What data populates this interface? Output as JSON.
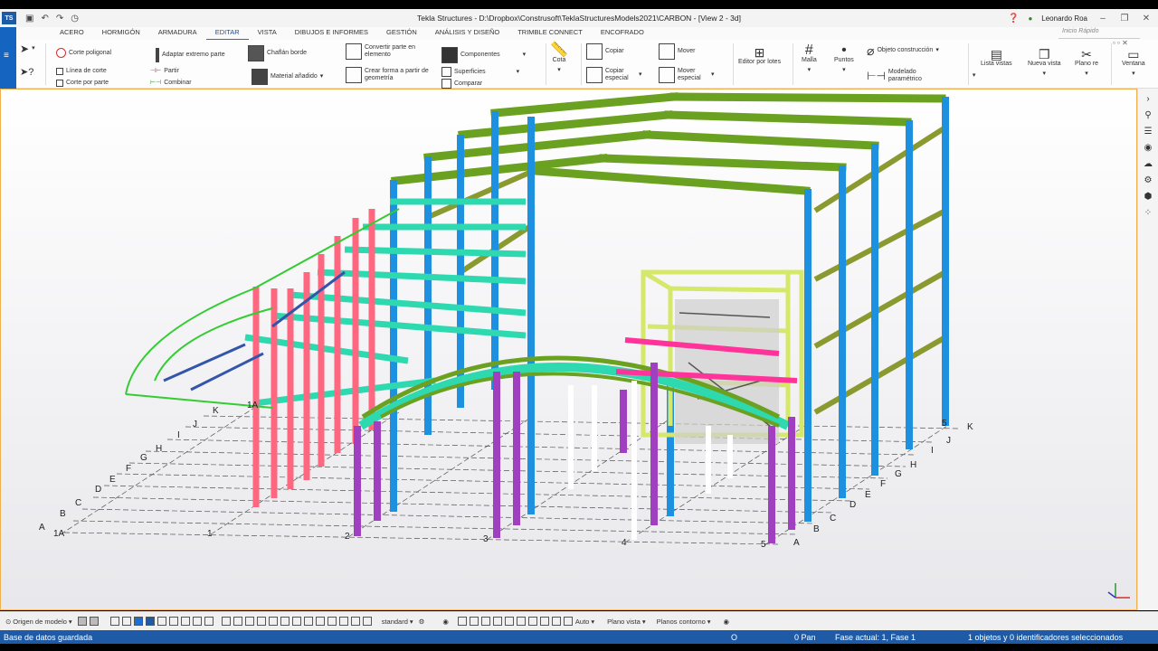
{
  "window": {
    "logo": "TS",
    "title": "Tekla Structures - D:\\Dropbox\\Construsoft\\TeklaStructuresModels2021\\CARBON  - [View 2 - 3d]",
    "user": "Leonardo Roa",
    "quick_search_placeholder": "Inicio Rápido"
  },
  "menu": {
    "items": [
      "ACERO",
      "HORMIGÓN",
      "ARMADURA",
      "EDITAR",
      "VISTA",
      "DIBUJOS E INFORMES",
      "GESTIÓN",
      "ANÁLISIS Y DISEÑO",
      "TRIMBLE CONNECT",
      "ENCOFRADO"
    ],
    "active": "EDITAR"
  },
  "ribbon": {
    "corte_poligonal": "Corte poligonal",
    "linea_de_corte": "Línea de corte",
    "corte_por_parte": "Corte por parte",
    "adaptar_extremo": "Adaptar extremo parte",
    "partir": "Partir",
    "combinar": "Combinar",
    "chaflan_borde": "Chaflán borde",
    "material_anadido": "Material añadido",
    "convertir": "Convertir parte en elemento",
    "crear_forma": "Crear forma a partir de geometría",
    "componentes": "Componentes",
    "superficies": "Superficies",
    "comparar": "Comparar",
    "cota": "Cota",
    "copiar": "Copiar",
    "copiar_especial": "Copiar especial",
    "mover": "Mover",
    "mover_especial": "Mover especial",
    "editor_lotes": "Editor por lotes",
    "malla": "Malla",
    "puntos": "Puntos",
    "objeto_construccion": "Objeto construcción",
    "modelado_parametrico": "Modelado paramétrico",
    "lista_vistas": "Lista vistas",
    "nueva_vista": "Nueva vista",
    "plano_re": "Plano re",
    "ventana": "Ventana"
  },
  "grid_labels": {
    "letters": [
      "A",
      "B",
      "C",
      "D",
      "E",
      "F",
      "G",
      "H",
      "I",
      "J",
      "K"
    ],
    "numbers": [
      "1A",
      "1",
      "2",
      "3",
      "4",
      "5"
    ]
  },
  "bottom_toolbar": {
    "origin": "Origen de modelo",
    "standard": "standard",
    "auto": "Auto",
    "plano_vista": "Plano vista",
    "planos_contorno": "Planos contorno"
  },
  "status": {
    "left": "Base de datos guardada",
    "o": "O",
    "pan": "0  Pan",
    "phase": "Fase actual: 1, Fase 1",
    "selection": "1 objetos y 0 identificadores seleccionados"
  },
  "colors": {
    "blue_column": "#1e90e0",
    "green_beam": "#6aa121",
    "teal_beam": "#2fd9b0",
    "pink_column": "#ff6680",
    "purple_column": "#a040c0",
    "yellow_frame": "#d6e86a",
    "status_blue": "#1f5aa6"
  }
}
